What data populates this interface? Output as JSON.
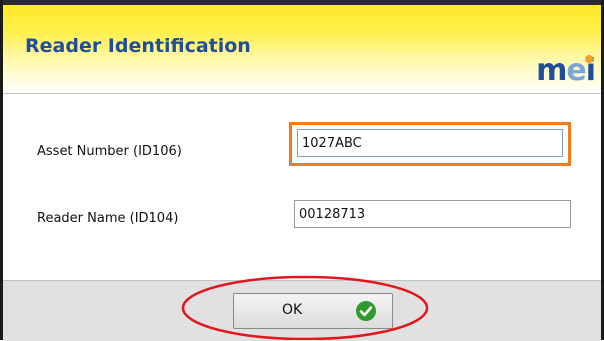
{
  "dialog": {
    "title": "Reader Identification",
    "logo": {
      "m": "m",
      "e": "e",
      "i": "i"
    }
  },
  "form": {
    "asset_number": {
      "label": "Asset Number (ID106)",
      "value": "1027ABC"
    },
    "reader_name": {
      "label": "Reader Name (ID104)",
      "value": "00128713"
    }
  },
  "footer": {
    "ok_label": "OK",
    "ok_icon": "check-circle-icon"
  },
  "colors": {
    "title": "#1f4f9a",
    "highlight_box": "#f07d1a",
    "annotation_ellipse": "#e3161c",
    "check_icon": "#2e9b2e"
  }
}
